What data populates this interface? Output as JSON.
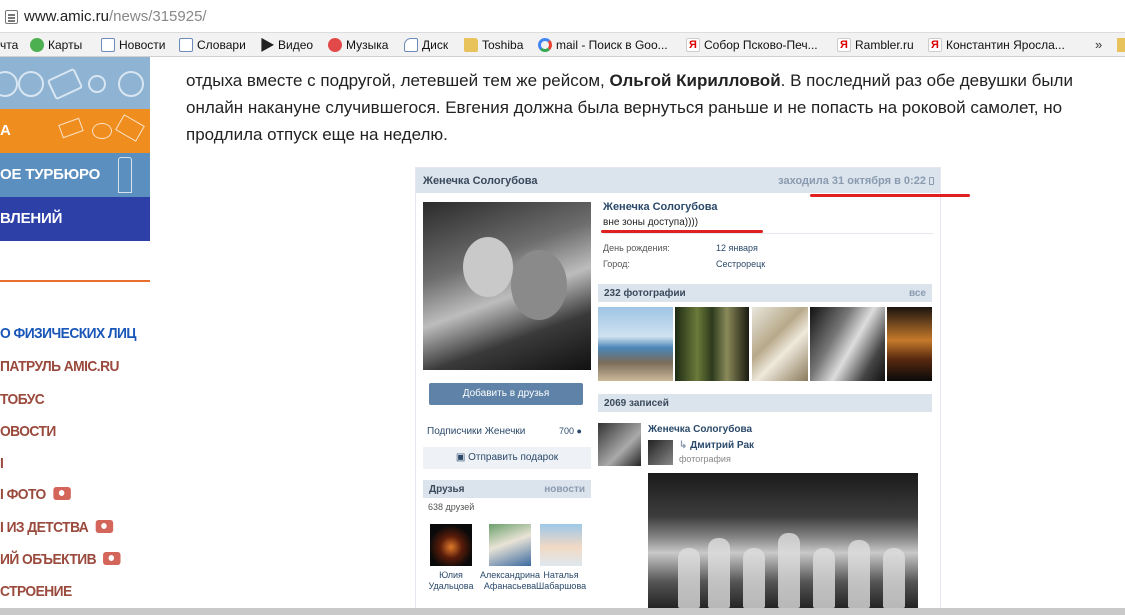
{
  "browser": {
    "url_host": "www.amic.ru",
    "url_path": "/news/315925/",
    "bookmarks": [
      {
        "label": "чта",
        "icon": "none"
      },
      {
        "label": "Карты",
        "icon": "maps-icon"
      },
      {
        "label": "Новости",
        "icon": "news-icon"
      },
      {
        "label": "Словари",
        "icon": "dictionary-icon"
      },
      {
        "label": "Видео",
        "icon": "video-icon"
      },
      {
        "label": "Музыка",
        "icon": "music-icon"
      },
      {
        "label": "Диск",
        "icon": "disk-icon"
      },
      {
        "label": "Toshiba",
        "icon": "folder-icon"
      },
      {
        "label": "mail - Поиск в Goo...",
        "icon": "google-icon"
      },
      {
        "label": "Собор Псково-Печ...",
        "icon": "yandex-icon"
      },
      {
        "label": "Rambler.ru",
        "icon": "yandex-icon"
      },
      {
        "label": "Константин Яросла...",
        "icon": "yandex-icon"
      }
    ],
    "more": "»"
  },
  "sidebar": {
    "bands": [
      {
        "label": "А",
        "color": "#f08d1f"
      },
      {
        "label": "ОЕ ТУРБЮРО",
        "color": "#5b8fc0"
      },
      {
        "label": "ВЛЕНИЙ",
        "color": "#2c40a8"
      }
    ],
    "menu": [
      {
        "label": "О ФИЗИЧЕСКИХ ЛИЦ",
        "camera": false
      },
      {
        "label": "ПАТРУЛЬ AMIC.RU",
        "camera": false
      },
      {
        "label": "ТОБУС",
        "camera": false
      },
      {
        "label": "ОВОСТИ",
        "camera": false
      },
      {
        "label": "І",
        "camera": false
      },
      {
        "label": "І ФОТО",
        "camera": true
      },
      {
        "label": "І ИЗ ДЕТСТВА",
        "camera": true
      },
      {
        "label": "ИЙ ОБЪЕКТИВ",
        "camera": true
      },
      {
        "label": "СТРОЕНИЕ",
        "camera": false
      }
    ]
  },
  "article": {
    "line1_pre": "отдыха вместе с подругой, летевшей тем же рейсом, ",
    "line1_bold": "Ольгой Кирилловой",
    "line1_post": ". В последний раз обе девушки были",
    "line2": "онлайн накануне случившегося. Евгения должна была вернуться раньше и не попасть на роковой самолет, но",
    "line3": "продлила отпуск еще на неделю."
  },
  "vk": {
    "header_name": "Женечка Сологубова",
    "last_seen": "заходила 31 октября в 0:22",
    "profile_name": "Женечка Сологубова",
    "status": "вне зоны доступа))))",
    "info": [
      {
        "label": "День рождения:",
        "value": "12 января"
      },
      {
        "label": "Город:",
        "value": "Сестрорецк"
      }
    ],
    "add_friend": "Добавить в друзья",
    "subscribers_label": "Подписчики Женечки",
    "subscribers_count": "700",
    "send_gift": "Отправить подарок",
    "friends_title": "Друзья",
    "friends_new": "новости",
    "friends_count": "638 друзей",
    "friends": [
      {
        "first": "Юлия",
        "last": "Удальцова"
      },
      {
        "first": "Александрина",
        "last": "Афанасьева"
      },
      {
        "first": "Наталья",
        "last": "Шабаршова"
      }
    ],
    "photos_title": "232 фотографии",
    "photos_all": "все",
    "posts_title": "2069 записей",
    "post_author": "Женечка Сологубова",
    "repost_name": "Дмитрий Рак",
    "repost_type": "фотография"
  },
  "colors": {
    "annotation_red": "#e02020",
    "vk_header_bg": "#dbe3ec",
    "vk_link": "#2b4a6b"
  }
}
